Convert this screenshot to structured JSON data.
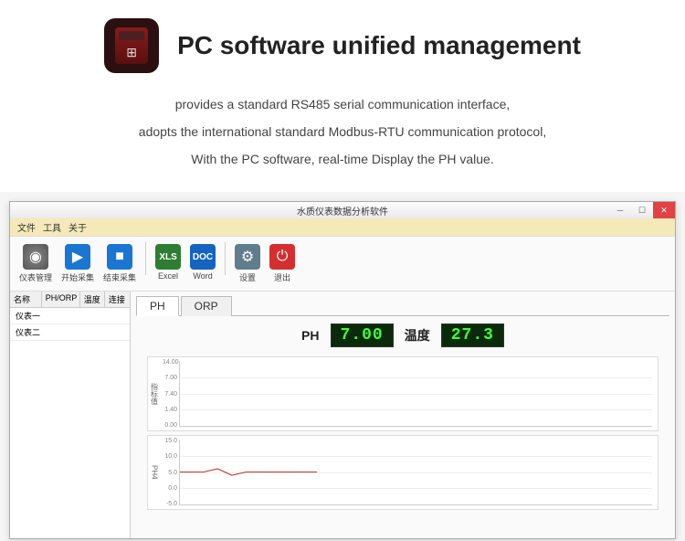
{
  "hero": {
    "title": "PC software unified management",
    "desc": [
      "provides a standard RS485 serial communication interface,",
      "adopts the international standard Modbus-RTU communication protocol,",
      "With the PC software, real-time Display the PH value."
    ]
  },
  "window": {
    "title": "水质仪表数据分析软件",
    "menu": [
      "文件",
      "工具",
      "关于"
    ]
  },
  "toolbar": [
    {
      "id": "instrument-manage",
      "label": "仪表管理",
      "icon": "ic-gauge",
      "glyph": "◉"
    },
    {
      "id": "start-acquire",
      "label": "开始采集",
      "icon": "ic-play",
      "glyph": "▶"
    },
    {
      "id": "end-acquire",
      "label": "结束采集",
      "icon": "ic-stop",
      "glyph": "■"
    },
    {
      "sep": true
    },
    {
      "id": "excel",
      "label": "Excel",
      "icon": "ic-xls",
      "glyph": "XLS"
    },
    {
      "id": "word",
      "label": "Word",
      "icon": "ic-doc",
      "glyph": "DOC"
    },
    {
      "sep": true
    },
    {
      "id": "settings",
      "label": "设置",
      "icon": "ic-gear",
      "glyph": "⚙"
    },
    {
      "id": "exit",
      "label": "退出",
      "icon": "ic-exit",
      "glyph": "⏻"
    }
  ],
  "sidebar": {
    "cols": [
      "名称",
      "PH/ORP",
      "温度",
      "连接"
    ],
    "rows": [
      "仪表一",
      "仪表二"
    ]
  },
  "tabs": {
    "items": [
      "PH",
      "ORP"
    ],
    "active": 0
  },
  "readout": {
    "ph_label": "PH",
    "ph_value": "7.00",
    "temp_label": "温度",
    "temp_value": "27.3"
  },
  "chart_data": [
    {
      "type": "line",
      "ylabel": "指标值",
      "yticks": [
        "14.00",
        "7.00",
        "7.40",
        "1.40",
        "0.00"
      ],
      "series": [
        {
          "name": "ph",
          "values": []
        }
      ]
    },
    {
      "type": "line",
      "ylabel": "PH4",
      "yticks": [
        "15.0",
        "10.0",
        "5.0",
        "0.0",
        "-5.0"
      ],
      "series": [
        {
          "name": "ph4",
          "values": [
            7,
            7,
            7.2,
            6.8,
            7,
            7,
            7,
            7,
            7,
            7
          ]
        }
      ]
    }
  ]
}
